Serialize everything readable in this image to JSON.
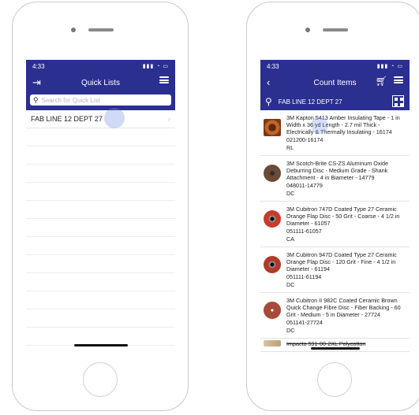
{
  "left": {
    "status_time": "4:33",
    "status_icons": "▮▮▮ ◔ ▭",
    "title": "Quick Lists",
    "search_placeholder": "Search for Quick List",
    "list_items": [
      {
        "label": "FAB LINE 12 DEPT 27"
      }
    ]
  },
  "right": {
    "status_time": "4:33",
    "status_icons": "▮▮▮ ◔ ▭",
    "title": "Count Items",
    "list_name": "FAB LINE 12 DEPT 27",
    "items": [
      {
        "thumb": "t-tape",
        "desc": "3M Kapton 5413 Amber Insulating Tape - 1 in Width x 36 yd Length - 2.7 mil Thick - Electrically & Thermally Insulating - 16174",
        "sku": "021200-16174",
        "uom": "RL"
      },
      {
        "thumb": "t-disc1",
        "desc": "3M Scotch-Brite CS-ZS Aluminum Oxide Deburring Disc - Medium Grade - Shank Attachment - 4 in Biameter - 14779",
        "sku": "048011-14779",
        "uom": "DC"
      },
      {
        "thumb": "t-disc2",
        "desc": "3M Cubitron 747D Coated Type 27 Ceramic Orange Flap Disc - 50 Grit - Coarse - 4 1/2 in Diameter - 61057",
        "sku": "051111-61057",
        "uom": "CA"
      },
      {
        "thumb": "t-disc3",
        "desc": "3M Cubitron 947D Coated Type 27 Ceramic Orange Flap Disc - 120 Grit - Fine - 4 1/2 in Diameter - 61194",
        "sku": "051111-61194",
        "uom": "DC"
      },
      {
        "thumb": "t-disc4",
        "desc": "3M Cubitron II 982C Coated Ceramic Brown Quick Change Fibre Disc - Fiber Backing - 60 Grit - Medium - 5 in Diameter - 27724",
        "sku": "051141-27724",
        "uom": "DC"
      }
    ],
    "partial_item": "Impacto 591-00-2XL Polycotton"
  },
  "colors": {
    "navbar": "#2b2f8f"
  }
}
